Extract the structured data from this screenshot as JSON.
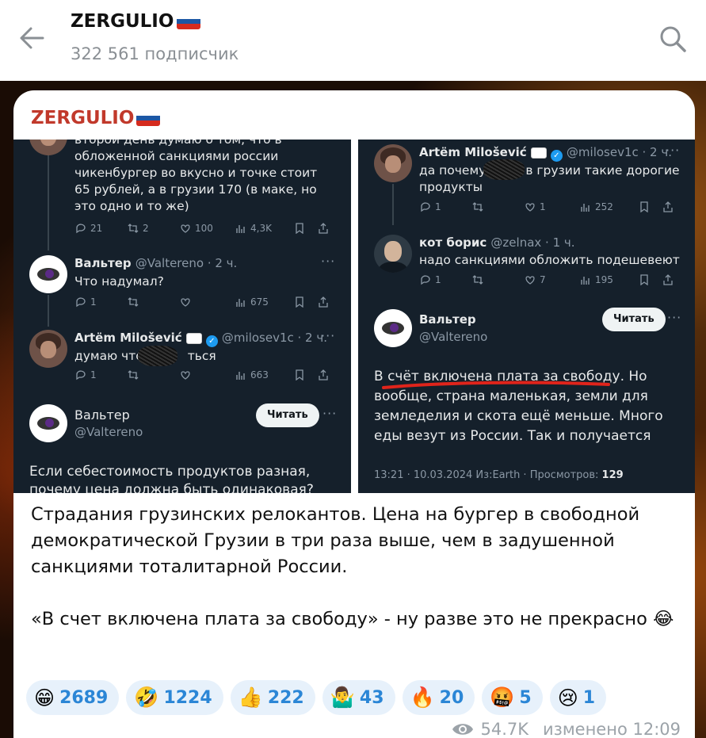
{
  "header": {
    "channel_name": "ZERGULIO",
    "subscribers": "322 561 подписчик",
    "back_icon": "arrow-left-icon",
    "search_icon": "search-icon"
  },
  "flag_colors": [
    "#ffffff",
    "#1c57a5",
    "#d52b1e"
  ],
  "post": {
    "author": "ZERGULIO",
    "left_screenshot": {
      "tweet1": {
        "text": "второй день думаю о том, что в обложенной санкциями россии чикенбургер во вкусно и точке стоит 65 рублей, а в грузии 170 (в маке, но это одно и то же)",
        "reply": "21",
        "retweet": "2",
        "like": "100",
        "views": "4,3K"
      },
      "tweet2": {
        "name": "Вальтер",
        "handle": "@Valtereno · 2 ч.",
        "text": "Что надумал?",
        "reply": "1",
        "views": "675"
      },
      "tweet3": {
        "name": "Artëm Milošević",
        "handle": "@milosev1c · 2 ч.",
        "text_before": "думаю что",
        "text_after": "ться",
        "reply": "1",
        "views": "663"
      },
      "tweet4": {
        "name": "Вальтер",
        "handle": "@Valtereno",
        "read_button": "Читать",
        "text": "Если себестоимость продуктов разная, почему цена должна быть одинаковая?"
      }
    },
    "right_screenshot": {
      "tweet1": {
        "name": "Artëm Milošević",
        "handle": "@milosev1c · 2 ч.",
        "text_before": "да почему",
        "text_after": "в грузии такие дорогие продукты",
        "reply": "1",
        "like": "1",
        "views": "252"
      },
      "tweet2": {
        "name": "кот борис",
        "handle": "@zelnax · 1 ч.",
        "text": "надо санкциями обложить подешевеют",
        "reply": "1",
        "like": "7",
        "views": "195"
      },
      "tweet3": {
        "name": "Вальтер",
        "handle": "@Valtereno",
        "read_button": "Читать",
        "text_underlined": "В счёт включена плата за свободу",
        "text_rest": ". Но вообще, страна маленькая, земли для земледелия и скота ещё меньше. Много еды везут из России. Так и получается",
        "footer_left": "13:21 · 10.03.2024 Из:Earth · Просмотров: ",
        "footer_views": "129"
      }
    },
    "body": [
      "Страдания грузинских релокантов. Цена на бургер в свободной демократической Грузии в три раза выше, чем в задушенной санкциями тоталитарной России.",
      "«В счет включена плата за свободу» - ну разве это не прекрасно 😂"
    ],
    "reactions": [
      {
        "emoji": "😁",
        "count": "2689"
      },
      {
        "emoji": "🤣",
        "count": "1224"
      },
      {
        "emoji": "👍",
        "count": "222"
      },
      {
        "emoji": "🤷‍♂️",
        "count": "43"
      },
      {
        "emoji": "🔥",
        "count": "20"
      },
      {
        "emoji": "🤬",
        "count": "5"
      },
      {
        "emoji": "😢",
        "count": "1"
      }
    ],
    "views": "54.7K",
    "edited": "изменено 12:09",
    "eye_icon": "eye-icon"
  }
}
